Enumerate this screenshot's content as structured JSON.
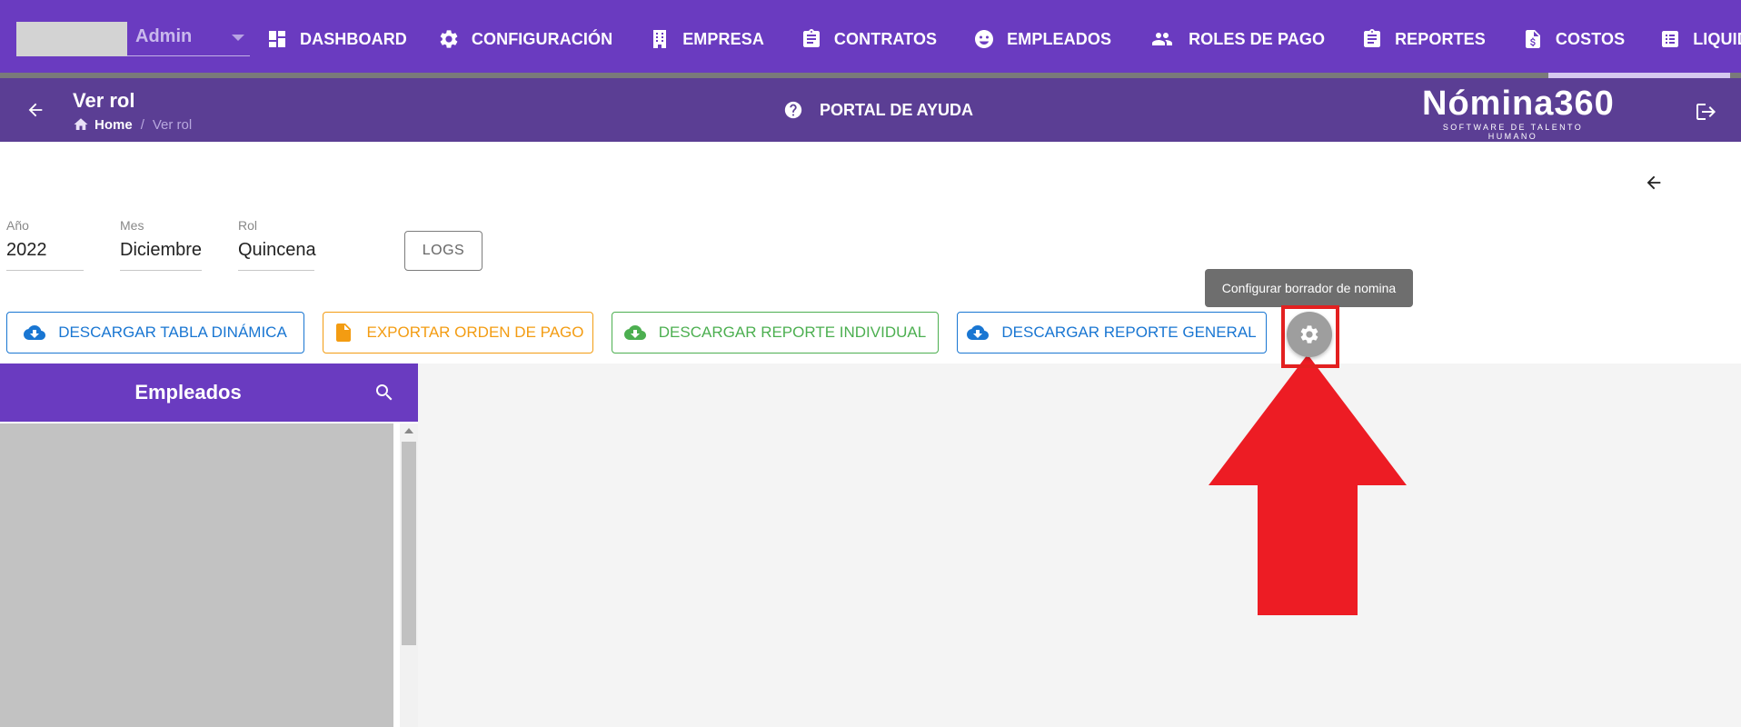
{
  "company": {
    "name": "Admin"
  },
  "nav": {
    "items": [
      {
        "label": "DASHBOARD",
        "icon": "dashboard-icon"
      },
      {
        "label": "CONFIGURACIÓN",
        "icon": "gear-icon"
      },
      {
        "label": "EMPRESA",
        "icon": "building-icon"
      },
      {
        "label": "CONTRATOS",
        "icon": "clipboard-icon"
      },
      {
        "label": "EMPLEADOS",
        "icon": "face-icon"
      },
      {
        "label": "ROLES DE PAGO",
        "icon": "people-icon"
      },
      {
        "label": "REPORTES",
        "icon": "clipboard-icon"
      },
      {
        "label": "COSTOS",
        "icon": "dollar-file-icon"
      },
      {
        "label": "LIQUIDACIONES",
        "icon": "list-icon"
      }
    ],
    "active": "LIQUIDACIONES"
  },
  "header": {
    "title": "Ver rol",
    "breadcrumb": {
      "home": "Home",
      "separator": "/",
      "current": "Ver rol"
    },
    "help_portal": "PORTAL DE AYUDA",
    "brand": {
      "name": "Nómina360",
      "tagline": "SOFTWARE DE TALENTO HUMANO"
    }
  },
  "filters": {
    "year": {
      "label": "Año",
      "value": "2022"
    },
    "month": {
      "label": "Mes",
      "value": "Diciembre"
    },
    "role": {
      "label": "Rol",
      "value": "Quincena"
    }
  },
  "logs_button": "LOGS",
  "actions": {
    "pivot_table": "DESCARGAR TABLA DINÁMICA",
    "export_payment_order": "EXPORTAR ORDEN DE PAGO",
    "individual_report": "DESCARGAR REPORTE INDIVIDUAL",
    "general_report": "DESCARGAR REPORTE GENERAL"
  },
  "tooltip": "Configurar borrador de nomina",
  "employees": {
    "title": "Empleados"
  },
  "colors": {
    "nav_bg": "#6a3bc0",
    "header_bg": "#5b3e94",
    "blue": "#1976d2",
    "orange": "#f39c12",
    "green": "#4caf50",
    "annotation_red": "#e32020"
  }
}
